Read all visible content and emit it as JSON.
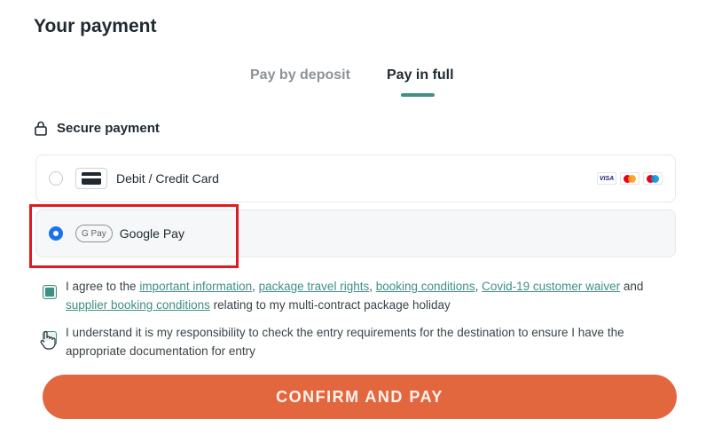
{
  "title": "Your payment",
  "tabs": [
    {
      "label": "Pay by deposit",
      "active": false
    },
    {
      "label": "Pay in full",
      "active": true
    }
  ],
  "secure": {
    "icon": "lock-icon",
    "label": "Secure payment"
  },
  "payment_options": [
    {
      "label": "Debit / Credit Card",
      "selected": false,
      "icon": "credit-card-icon",
      "brands": [
        "VISA",
        "mastercard",
        "maestro"
      ]
    },
    {
      "label": "Google Pay",
      "selected": true,
      "icon": "google-pay-icon",
      "badge": "G Pay"
    }
  ],
  "agreements": {
    "first": {
      "checked": true,
      "prefix": "I agree to the ",
      "link1": "important information",
      "sep1": ", ",
      "link2": "package travel rights",
      "sep2": ", ",
      "link3": "booking conditions",
      "sep3": ", ",
      "link4": "Covid-19 customer waiver",
      "and": " and ",
      "link5": "supplier booking conditions",
      "suffix": " relating to my multi-contract package holiday"
    },
    "second": {
      "checked": false,
      "text": "I understand it is my responsibility to check the entry requirements for the destination to ensure I have the appropriate documentation for entry"
    }
  },
  "confirm_label": "CONFIRM AND PAY",
  "colors": {
    "accent": "#3f8f85",
    "confirm": "#e2673f",
    "radio_selected": "#1a73e8",
    "highlight": "#e11b22"
  }
}
